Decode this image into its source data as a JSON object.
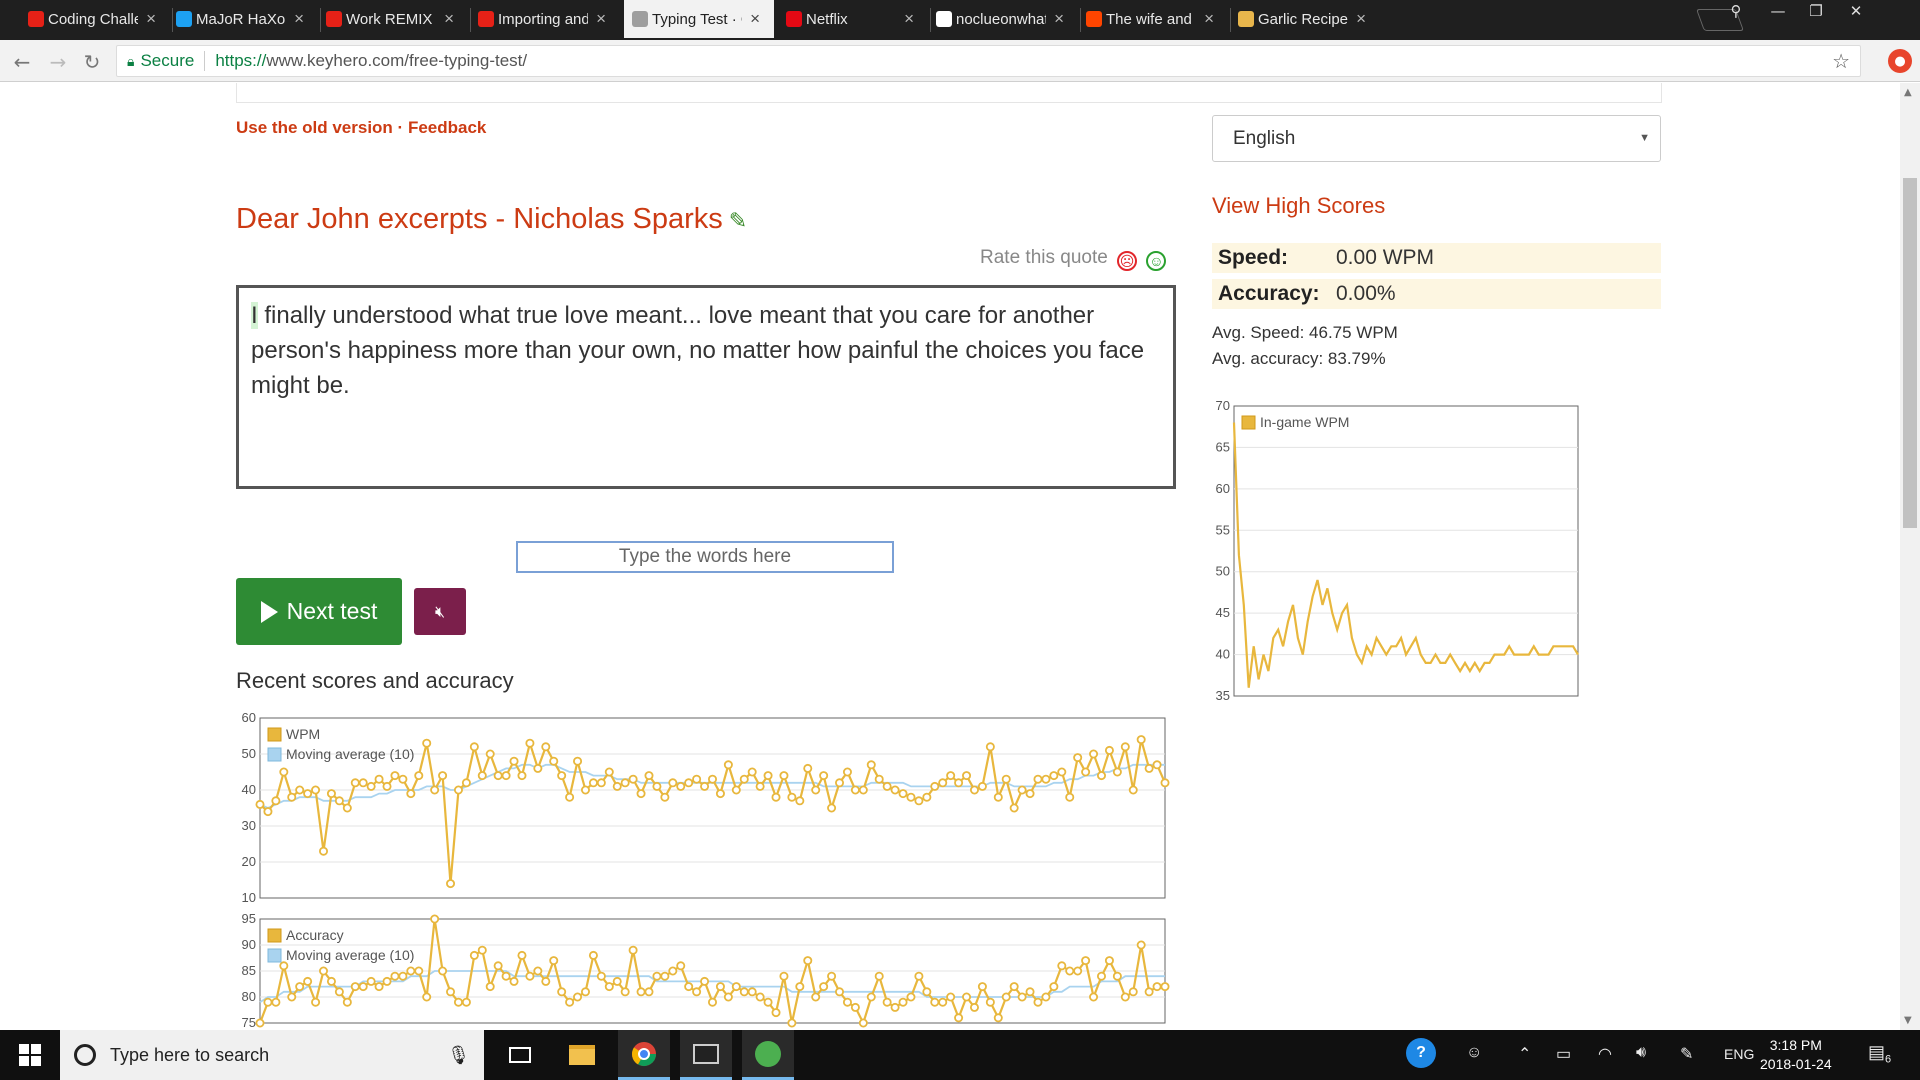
{
  "browser": {
    "tabs": [
      {
        "title": "Coding Challeng",
        "fav": "#e62117"
      },
      {
        "title": "MaJoR HaXoR (@",
        "fav": "#1da1f2"
      },
      {
        "title": "Work REMIX |",
        "fav": "#e62117"
      },
      {
        "title": "Importing and e",
        "fav": "#e62117"
      },
      {
        "title": "Typing Test · Che",
        "fav": "#9e9e9e"
      },
      {
        "title": "Netflix",
        "fav": "#e50914"
      },
      {
        "title": "noclueonwhatto",
        "fav": "#ffffff"
      },
      {
        "title": "The wife and the",
        "fav": "#ff4500"
      },
      {
        "title": "Garlic Recipes -",
        "fav": "#e8b64c"
      }
    ],
    "close_glyph": "×",
    "secure_label": "Secure",
    "url_proto": "https://",
    "url_rest": "www.keyhero.com/free-typing-test/"
  },
  "page": {
    "old_version_link": "Use the old version",
    "separator": " · ",
    "feedback_link": "Feedback",
    "quote_title": "Dear John excerpts - Nicholas Sparks",
    "rate_label": "Rate this quote",
    "quote_first_char": "I",
    "quote_rest": " finally understood what true love meant... love meant that you care for another person's happiness more than your own, no matter how painful the choices you face might be.",
    "input_placeholder": "Type the words here",
    "next_button": "Next test",
    "recent_heading": "Recent scores and accuracy",
    "language_selected": "English",
    "high_scores_link": "View High Scores",
    "speed_label": "Speed:",
    "speed_value": "0.00 WPM",
    "accuracy_label": "Accuracy:",
    "accuracy_value": "0.00%",
    "avg_speed": "Avg. Speed: 46.75 WPM",
    "avg_accuracy": "Avg. accuracy: 83.79%",
    "accent_color": "#cc3b13",
    "button_green": "#2e8b34",
    "mute_color": "#7b1f4b"
  },
  "taskbar": {
    "search_placeholder": "Type here to search",
    "lang": "ENG",
    "time": "3:18 PM",
    "date": "2018-01-24",
    "notif_count": "6"
  },
  "chart_data": [
    {
      "type": "line",
      "name": "in-game-wpm",
      "legend": [
        "In-game WPM"
      ],
      "ylim": [
        35,
        70
      ],
      "yticks": [
        35,
        40,
        45,
        50,
        55,
        60,
        65,
        70
      ],
      "series": [
        {
          "name": "In-game WPM",
          "values": [
            68,
            52,
            46,
            36,
            41,
            37,
            40,
            38,
            42,
            43,
            41,
            44,
            46,
            42,
            40,
            44,
            47,
            49,
            46,
            48,
            45,
            43,
            45,
            46,
            42,
            40,
            39,
            41,
            40,
            42,
            41,
            40,
            41,
            41,
            42,
            40,
            41,
            42,
            40,
            39,
            39,
            40,
            39,
            39,
            40,
            39,
            38,
            39,
            38,
            39,
            38,
            39,
            39,
            40,
            40,
            40,
            41,
            40,
            40,
            40,
            40,
            41,
            40,
            40,
            40,
            41,
            41,
            41,
            41,
            41,
            40
          ]
        }
      ]
    },
    {
      "type": "line",
      "name": "recent-wpm",
      "legend": [
        "WPM",
        "Moving average (10)"
      ],
      "ylim": [
        10,
        60
      ],
      "yticks": [
        10,
        20,
        30,
        40,
        50,
        60
      ],
      "series": [
        {
          "name": "WPM",
          "values": [
            36,
            34,
            37,
            45,
            38,
            40,
            39,
            40,
            23,
            39,
            37,
            35,
            42,
            42,
            41,
            43,
            41,
            44,
            43,
            39,
            44,
            53,
            40,
            44,
            14,
            40,
            42,
            52,
            44,
            50,
            44,
            44,
            48,
            44,
            53,
            46,
            52,
            48,
            44,
            38,
            48,
            40,
            42,
            42,
            45,
            41,
            42,
            43,
            39,
            44,
            41,
            38,
            42,
            41,
            42,
            43,
            41,
            43,
            39,
            47,
            40,
            43,
            45,
            41,
            44,
            38,
            44,
            38,
            37,
            46,
            40,
            44,
            35,
            42,
            45,
            40,
            40,
            47,
            43,
            41,
            40,
            39,
            38,
            37,
            38,
            41,
            42,
            44,
            42,
            44,
            40,
            41,
            52,
            38,
            43,
            35,
            40,
            39,
            43,
            43,
            44,
            45,
            38,
            49,
            45,
            50,
            44,
            51,
            45,
            52,
            40,
            54,
            46,
            47,
            42
          ]
        },
        {
          "name": "Moving average (10)",
          "values": [
            36,
            35,
            36,
            37,
            37,
            38,
            38,
            38,
            37,
            37,
            37,
            37,
            38,
            38,
            38,
            39,
            39,
            40,
            40,
            40,
            40,
            41,
            41,
            41,
            40,
            40,
            41,
            42,
            43,
            44,
            45,
            46,
            46,
            47,
            47,
            46,
            47,
            47,
            46,
            45,
            45,
            45,
            44,
            44,
            44,
            43,
            43,
            43,
            42,
            42,
            42,
            42,
            42,
            42,
            42,
            42,
            42,
            42,
            42,
            42,
            42,
            42,
            42,
            42,
            42,
            42,
            42,
            42,
            42,
            42,
            42,
            41,
            41,
            41,
            41,
            41,
            41,
            42,
            42,
            42,
            42,
            42,
            41,
            41,
            41,
            41,
            41,
            41,
            41,
            41,
            41,
            41,
            42,
            42,
            42,
            41,
            41,
            41,
            41,
            41,
            42,
            42,
            43,
            43,
            44,
            44,
            45,
            45,
            46,
            46,
            47,
            47,
            47,
            47,
            47
          ]
        }
      ]
    },
    {
      "type": "line",
      "name": "recent-accuracy",
      "legend": [
        "Accuracy",
        "Moving average (10)"
      ],
      "ylim": [
        75,
        95
      ],
      "yticks": [
        75,
        80,
        85,
        90,
        95
      ],
      "series": [
        {
          "name": "Accuracy",
          "values": [
            75,
            79,
            79,
            86,
            80,
            82,
            83,
            79,
            85,
            83,
            81,
            79,
            82,
            82,
            83,
            82,
            83,
            84,
            84,
            85,
            85,
            80,
            95,
            85,
            81,
            79,
            79,
            88,
            89,
            82,
            86,
            84,
            83,
            88,
            84,
            85,
            83,
            87,
            81,
            79,
            80,
            81,
            88,
            84,
            82,
            83,
            81,
            89,
            81,
            81,
            84,
            84,
            85,
            86,
            82,
            81,
            83,
            79,
            82,
            80,
            82,
            81,
            81,
            80,
            79,
            77,
            84,
            75,
            82,
            87,
            80,
            82,
            84,
            81,
            79,
            78,
            73,
            80,
            84,
            79,
            78,
            79,
            80,
            84,
            81,
            79,
            79,
            80,
            76,
            80,
            78,
            82,
            79,
            76,
            80,
            82,
            80,
            81,
            79,
            80,
            82,
            86,
            85,
            85,
            87,
            80,
            84,
            87,
            84,
            80,
            81,
            90,
            81,
            82,
            82
          ]
        },
        {
          "name": "Moving average (10)",
          "values": [
            79,
            80,
            80,
            81,
            81,
            81,
            82,
            82,
            82,
            82,
            82,
            82,
            82,
            83,
            83,
            83,
            83,
            83,
            83,
            84,
            84,
            84,
            85,
            85,
            85,
            85,
            85,
            85,
            85,
            85,
            85,
            85,
            84,
            84,
            84,
            84,
            84,
            84,
            84,
            84,
            84,
            84,
            84,
            84,
            84,
            84,
            84,
            84,
            84,
            84,
            83,
            83,
            83,
            83,
            83,
            83,
            83,
            83,
            83,
            83,
            82,
            82,
            82,
            82,
            82,
            82,
            82,
            81,
            81,
            81,
            81,
            81,
            81,
            81,
            81,
            81,
            81,
            81,
            81,
            81,
            81,
            81,
            81,
            81,
            80,
            80,
            80,
            80,
            80,
            80,
            80,
            80,
            80,
            80,
            80,
            80,
            80,
            80,
            80,
            80,
            81,
            81,
            82,
            82,
            82,
            82,
            83,
            83,
            83,
            84,
            84,
            84,
            84,
            84,
            84
          ]
        }
      ]
    }
  ]
}
